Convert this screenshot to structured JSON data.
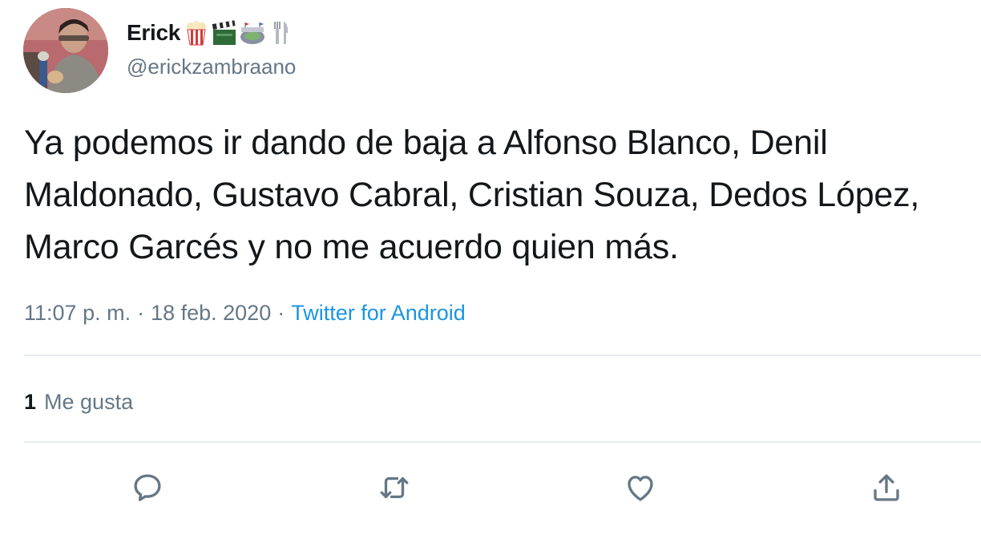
{
  "user": {
    "display_name": "Erick",
    "handle": "@erickzambraano",
    "name_emojis": [
      "popcorn-icon",
      "clapper-board-icon",
      "stadium-icon",
      "fork-and-knife-icon"
    ]
  },
  "tweet": {
    "text": "Ya podemos ir dando de baja a Alfonso Blanco, Denil Maldonado, Gustavo Cabral, Cristian Souza, Dedos López, Marco Garcés y no me acuerdo quien más.",
    "time": "11:07 p. m.",
    "separator": "·",
    "date": "18 feb. 2020",
    "source": "Twitter for Android"
  },
  "stats": {
    "likes_count": "1",
    "likes_label": "Me gusta"
  },
  "actions": {
    "reply_icon": "speech-bubble-icon",
    "retweet_icon": "retweet-icon",
    "like_icon": "heart-icon",
    "share_icon": "share-upload-icon"
  },
  "colors": {
    "text_primary": "#14171a",
    "text_secondary": "#657786",
    "link": "#1b95e0",
    "divider": "#e6ecf0"
  }
}
